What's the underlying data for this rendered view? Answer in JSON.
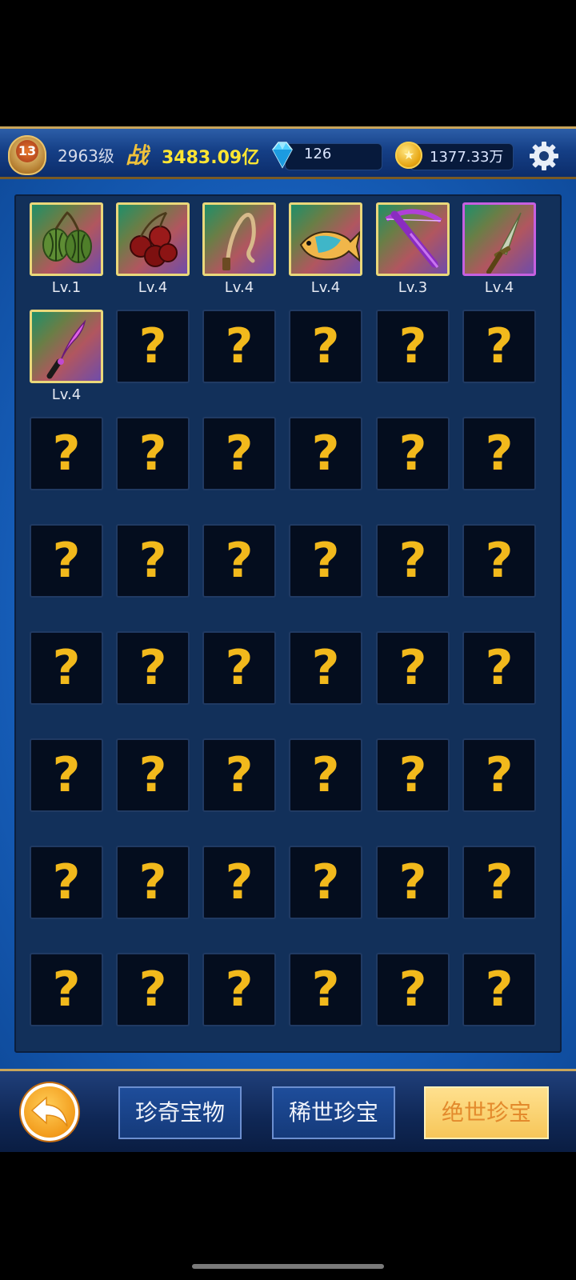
{
  "header": {
    "rank_badge": "13",
    "player_level": "2963级",
    "power_label": "战",
    "power_value": "3483.09亿",
    "gems": "126",
    "coins": "1377.33万",
    "icons": {
      "gem": "diamond-icon",
      "coin": "gold-coin-icon",
      "settings": "gear-icon"
    }
  },
  "collection": {
    "columns": 6,
    "rows": 8,
    "unlocked": [
      {
        "level": "Lv.1",
        "icon": "gooseberry-icon",
        "rarity": "gold"
      },
      {
        "level": "Lv.4",
        "icon": "cherries-icon",
        "rarity": "gold"
      },
      {
        "level": "Lv.4",
        "icon": "whip-icon",
        "rarity": "gold"
      },
      {
        "level": "Lv.4",
        "icon": "fish-icon",
        "rarity": "gold"
      },
      {
        "level": "Lv.3",
        "icon": "crossbow-icon",
        "rarity": "gold"
      },
      {
        "level": "Lv.4",
        "icon": "dagger-icon",
        "rarity": "purple"
      },
      {
        "level": "Lv.4",
        "icon": "curved-knife-icon",
        "rarity": "gold"
      }
    ],
    "locked_symbol": "?"
  },
  "footer": {
    "back_icon": "back-arrow-icon",
    "tabs": [
      {
        "label": "珍奇宝物",
        "active": false
      },
      {
        "label": "稀世珍宝",
        "active": false
      },
      {
        "label": "绝世珍宝",
        "active": true
      }
    ]
  },
  "colors": {
    "accent_gold": "#f2b91c",
    "frame_blue": "#1760bd",
    "panel": "#12305a"
  }
}
